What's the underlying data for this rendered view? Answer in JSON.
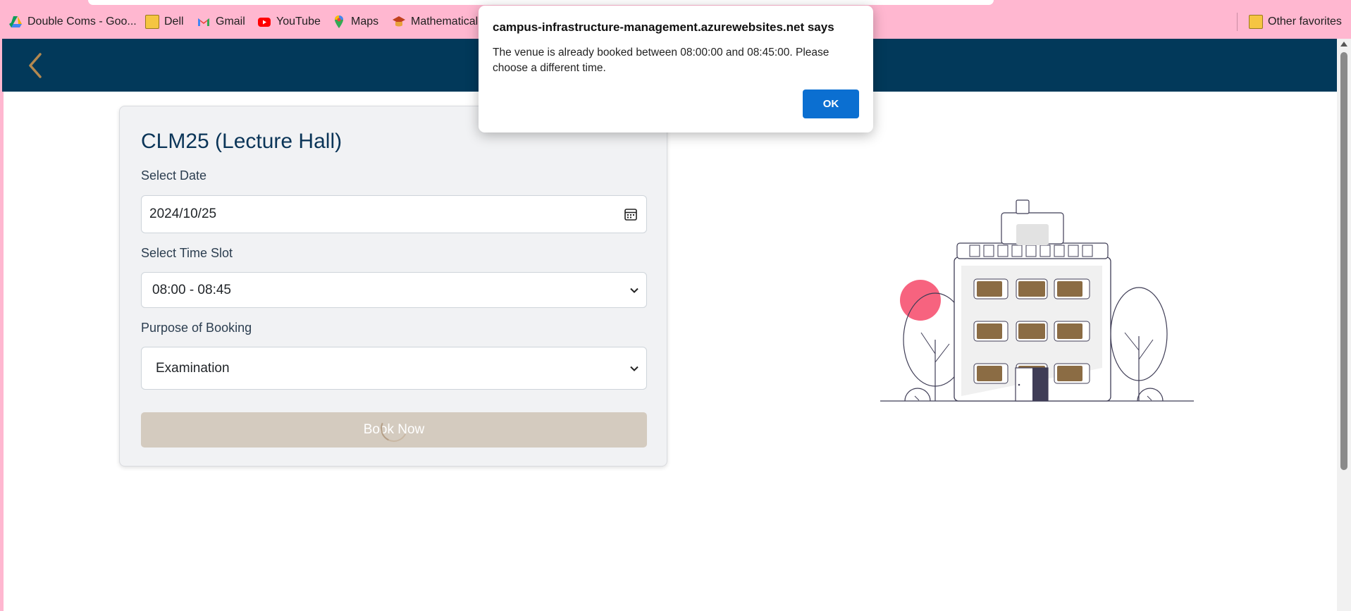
{
  "bookmarks": {
    "items": [
      {
        "label": "Double Coms - Goo...",
        "icon": "google-drive-icon"
      },
      {
        "label": "Dell",
        "icon": "folder-icon"
      },
      {
        "label": "Gmail",
        "icon": "gmail-icon"
      },
      {
        "label": "YouTube",
        "icon": "youtube-icon"
      },
      {
        "label": "Maps",
        "icon": "maps-icon"
      },
      {
        "label": "Mathematical",
        "icon": "mathematical-icon"
      }
    ],
    "other_favorites": "Other favorites"
  },
  "dialog": {
    "title": "campus-infrastructure-management.azurewebsites.net says",
    "message": "The venue is already booked between 08:00:00 and 08:45:00. Please choose a different time.",
    "ok_label": "OK"
  },
  "booking": {
    "venue_title": "CLM25 (Lecture Hall)",
    "date_label": "Select Date",
    "date_value": "2024/10/25",
    "time_label": "Select Time Slot",
    "time_value": "08:00 - 08:45",
    "purpose_label": "Purpose of Booking",
    "purpose_value": "Examination",
    "book_label": "Book Now"
  },
  "colors": {
    "header": "#02395a",
    "accent_gold": "#b3884f",
    "window_fill": "#8b6c44",
    "pink_circle": "#f7637f",
    "ok_button": "#0b6fd1"
  }
}
